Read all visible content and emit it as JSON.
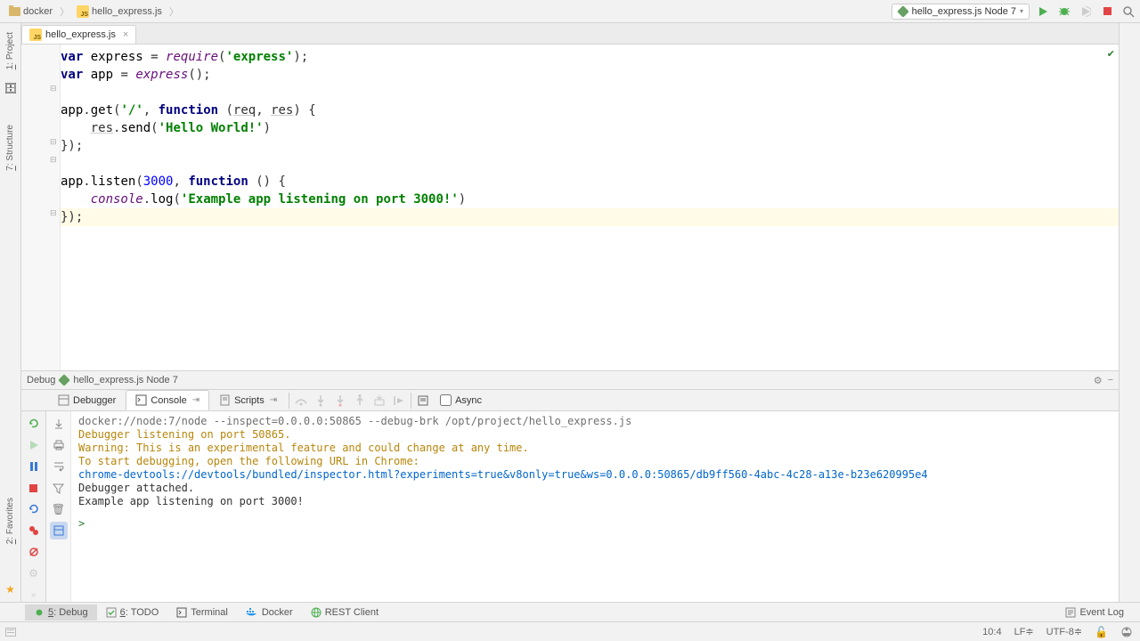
{
  "breadcrumb": {
    "folder": "docker",
    "file": "hello_express.js"
  },
  "run_config": "hello_express.js Node 7",
  "file_tab": "hello_express.js",
  "code": {
    "l1a": "var ",
    "l1b": "express",
    "l1c": " = ",
    "l1d": "require",
    "l1e": "(",
    "l1f": "'express'",
    "l1g": ");",
    "l2a": "var ",
    "l2b": "app",
    "l2c": " = ",
    "l2d": "express",
    "l2e": "();",
    "l4a": "app",
    "l4b": ".",
    "l4c": "get",
    "l4d": "(",
    "l4e": "'/'",
    "l4f": ", ",
    "l4g": "function ",
    "l4h": "(",
    "l4i": "req",
    "l4j": ", ",
    "l4k": "res",
    "l4l": ") {",
    "l5a": "    ",
    "l5b": "res",
    "l5c": ".",
    "l5d": "send",
    "l5e": "(",
    "l5f": "'Hello World!'",
    "l5g": ")",
    "l6": "});",
    "l8a": "app",
    "l8b": ".",
    "l8c": "listen",
    "l8d": "(",
    "l8e": "3000",
    "l8f": ", ",
    "l8g": "function ",
    "l8h": "() {",
    "l9a": "    ",
    "l9b": "console",
    "l9c": ".",
    "l9d": "log",
    "l9e": "(",
    "l9f": "'Example app listening on port 3000!'",
    "l9g": ")",
    "l10": "});"
  },
  "debug_panel": {
    "title_prefix": "Debug",
    "title": "hello_express.js Node 7"
  },
  "debug_tabs": {
    "debugger": "Debugger",
    "console": "Console",
    "scripts": "Scripts",
    "async": "Async"
  },
  "console": {
    "cmd": "docker://node:7/node --inspect=0.0.0.0:50865 --debug-brk /opt/project/hello_express.js",
    "l1": "Debugger listening on port 50865.",
    "l2": "Warning: This is an experimental feature and could change at any time.",
    "l3": "To start debugging, open the following URL in Chrome:",
    "l4": "    chrome-devtools://devtools/bundled/inspector.html?experiments=true&v8only=true&ws=0.0.0.0:50865/db9ff560-4abc-4c28-a13e-b23e620995e4",
    "l5": "Debugger attached.",
    "l6": "Example app listening on port 3000!",
    "prompt": ">"
  },
  "tool_tabs": {
    "debug_n": "5",
    "debug": ": Debug",
    "todo_n": "6",
    "todo": ": TODO",
    "terminal": "Terminal",
    "docker": "Docker",
    "rest": "REST Client",
    "eventlog": "Event Log"
  },
  "sidebar": {
    "project_n": "1",
    "project": ": Project",
    "structure_n": "7",
    "structure": ": Structure",
    "favorites_n": "2",
    "favorites": ": Favorites"
  },
  "status": {
    "pos": "10:4",
    "lf": "LF≑",
    "enc": "UTF-8≑",
    "lock": "🔓"
  }
}
